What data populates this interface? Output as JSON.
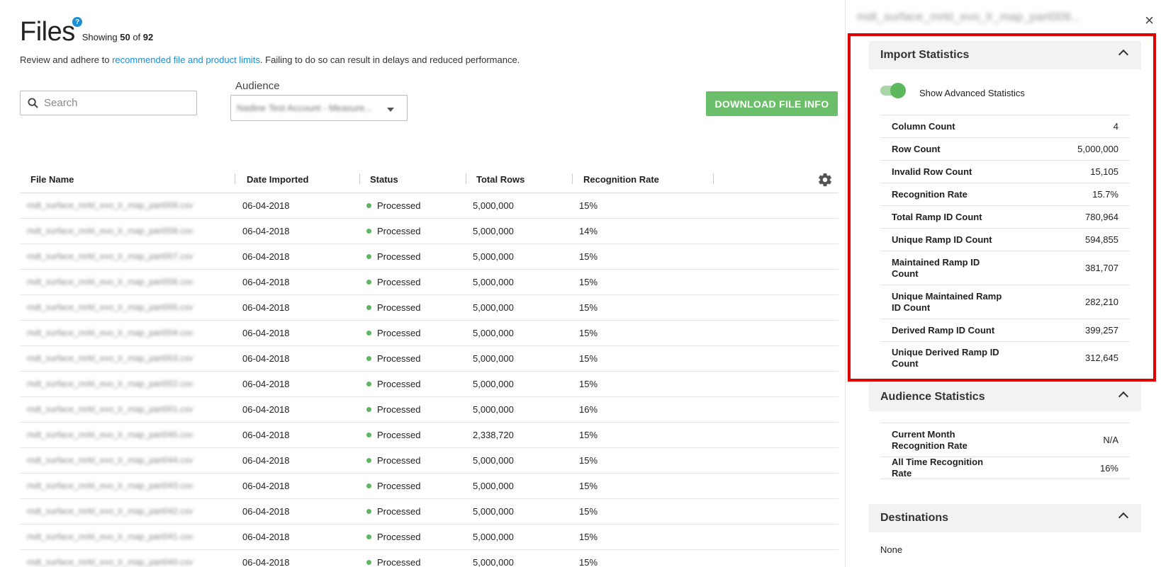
{
  "header": {
    "title": "Files",
    "help_glyph": "?",
    "showing_prefix": "Showing",
    "showing_count": "50",
    "showing_of": "of",
    "showing_total": "92",
    "notice_prefix": "Review and adhere to ",
    "notice_link": "recommended file and product limits",
    "notice_suffix": ". Failing to do so can result in delays and reduced performance."
  },
  "search": {
    "placeholder": "Search"
  },
  "audience": {
    "label": "Audience",
    "selected": "Nadine Test Account - Measure..."
  },
  "download_button": "DOWNLOAD FILE INFO",
  "table": {
    "columns": [
      "File Name",
      "Date Imported",
      "Status",
      "Total Rows",
      "Recognition Rate"
    ],
    "rows": [
      {
        "name": "mdt_surface_mrkt_evo_lr_map_part009.csv",
        "date": "06-04-2018",
        "status": "Processed",
        "rows": "5,000,000",
        "rate": "15%"
      },
      {
        "name": "mdt_surface_mrkt_evo_lr_map_part008.csv",
        "date": "06-04-2018",
        "status": "Processed",
        "rows": "5,000,000",
        "rate": "14%"
      },
      {
        "name": "mdt_surface_mrkt_evo_lr_map_part007.csv",
        "date": "06-04-2018",
        "status": "Processed",
        "rows": "5,000,000",
        "rate": "15%"
      },
      {
        "name": "mdt_surface_mrkt_evo_lr_map_part006.csv",
        "date": "06-04-2018",
        "status": "Processed",
        "rows": "5,000,000",
        "rate": "15%"
      },
      {
        "name": "mdt_surface_mrkt_evo_lr_map_part005.csv",
        "date": "06-04-2018",
        "status": "Processed",
        "rows": "5,000,000",
        "rate": "15%"
      },
      {
        "name": "mdt_surface_mrkt_evo_lr_map_part004.csv",
        "date": "06-04-2018",
        "status": "Processed",
        "rows": "5,000,000",
        "rate": "15%"
      },
      {
        "name": "mdt_surface_mrkt_evo_lr_map_part003.csv",
        "date": "06-04-2018",
        "status": "Processed",
        "rows": "5,000,000",
        "rate": "15%"
      },
      {
        "name": "mdt_surface_mrkt_evo_lr_map_part002.csv",
        "date": "06-04-2018",
        "status": "Processed",
        "rows": "5,000,000",
        "rate": "15%"
      },
      {
        "name": "mdt_surface_mrkt_evo_lr_map_part001.csv",
        "date": "06-04-2018",
        "status": "Processed",
        "rows": "5,000,000",
        "rate": "16%"
      },
      {
        "name": "mdt_surface_mrkt_evo_lr_map_part045.csv",
        "date": "06-04-2018",
        "status": "Processed",
        "rows": "2,338,720",
        "rate": "15%"
      },
      {
        "name": "mdt_surface_mrkt_evo_lr_map_part044.csv",
        "date": "06-04-2018",
        "status": "Processed",
        "rows": "5,000,000",
        "rate": "15%"
      },
      {
        "name": "mdt_surface_mrkt_evo_lr_map_part043.csv",
        "date": "06-04-2018",
        "status": "Processed",
        "rows": "5,000,000",
        "rate": "15%"
      },
      {
        "name": "mdt_surface_mrkt_evo_lr_map_part042.csv",
        "date": "06-04-2018",
        "status": "Processed",
        "rows": "5,000,000",
        "rate": "15%"
      },
      {
        "name": "mdt_surface_mrkt_evo_lr_map_part041.csv",
        "date": "06-04-2018",
        "status": "Processed",
        "rows": "5,000,000",
        "rate": "15%"
      },
      {
        "name": "mdt_surface_mrkt_evo_lr_map_part040.csv",
        "date": "06-04-2018",
        "status": "Processed",
        "rows": "5,000,000",
        "rate": "15%"
      }
    ]
  },
  "panel": {
    "title": "mdt_surface_mrkt_evo_lr_map_part009...",
    "close_glyph": "×",
    "import_stats": {
      "heading": "Import Statistics",
      "toggle_label": "Show Advanced Statistics",
      "toggle_on": true,
      "items": [
        {
          "k": "Column Count",
          "v": "4"
        },
        {
          "k": "Row Count",
          "v": "5,000,000"
        },
        {
          "k": "Invalid Row Count",
          "v": "15,105"
        },
        {
          "k": "Recognition Rate",
          "v": "15.7%"
        },
        {
          "k": "Total Ramp ID Count",
          "v": "780,964"
        },
        {
          "k": "Unique Ramp ID Count",
          "v": "594,855"
        },
        {
          "k": "Maintained Ramp ID Count",
          "v": "381,707"
        },
        {
          "k": "Unique Maintained Ramp ID Count",
          "v": "282,210"
        },
        {
          "k": "Derived Ramp ID Count",
          "v": "399,257"
        },
        {
          "k": "Unique Derived Ramp ID Count",
          "v": "312,645"
        }
      ]
    },
    "audience_stats": {
      "heading": "Audience Statistics",
      "items": [
        {
          "k": "Current Month Recognition Rate",
          "v": "N/A"
        },
        {
          "k": "All Time Recognition Rate",
          "v": "16%"
        }
      ]
    },
    "destinations": {
      "heading": "Destinations",
      "value": "None"
    }
  },
  "colors": {
    "accent_blue": "#1a8fd6",
    "button_green": "#6cbf6a",
    "status_green": "#5cb85c",
    "highlight_red": "#e00000"
  }
}
